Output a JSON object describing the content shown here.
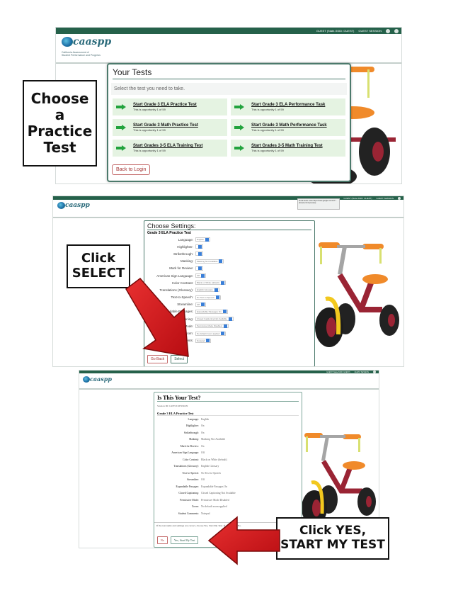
{
  "steps": [
    {
      "callout": "Choose a Practice Test",
      "callout_lines": [
        "Choose",
        "a",
        "Practice",
        "Test"
      ],
      "app": {
        "user_info": "GUEST (State-SSID: GUEST)",
        "session_label": "GUEST SESSION",
        "logo_word": "caaspp",
        "logo_sub": [
          "California Assessment of",
          "Student Performance and Progress"
        ]
      },
      "panel": {
        "title": "Your Tests",
        "instructions": "Select the test you need to take.",
        "tests": [
          {
            "label": "Start Grade 3 ELA Practice Test",
            "opportunity": "This is opportunity 1 of 59"
          },
          {
            "label": "Start Grade 3 ELA Performance Task",
            "opportunity": "This is opportunity 1 of 59"
          },
          {
            "label": "Start Grade 3 Math Practice Test",
            "opportunity": "This is opportunity 1 of 59"
          },
          {
            "label": "Start Grade 3 Math Performance Task",
            "opportunity": "This is opportunity 1 of 59"
          },
          {
            "label": "Start Grades 3-5 ELA Training Test",
            "opportunity": "This is opportunity 1 of 59"
          },
          {
            "label": "Start Grades 3-5 Math Training Test",
            "opportunity": "This is opportunity 1 of 59"
          }
        ],
        "back_button": "Back to Login"
      }
    },
    {
      "callout_lines": [
        "Click",
        "SELECT"
      ],
      "app": {
        "user_info": "GUEST (State-SSID: GUEST)",
        "session_label": "GUEST SESSION",
        "logo_word": "caaspp",
        "tooltip": "Kiosk Exam Links https://www.google.com/url?... (browser link preview)"
      },
      "panel": {
        "title": "Choose Settings:",
        "test_name": "Grade 3 ELA Practice Test",
        "settings": [
          {
            "label": "Language:",
            "value": "English"
          },
          {
            "label": "Highlighter:",
            "value": ""
          },
          {
            "label": "Strikethrough:",
            "value": ""
          },
          {
            "label": "Masking:",
            "value": "Masking Not Available"
          },
          {
            "label": "Mark for Review:",
            "value": ""
          },
          {
            "label": "American Sign Language:",
            "value": "Off"
          },
          {
            "label": "Color Contrast:",
            "value": "Black on White (default)"
          },
          {
            "label": "Translations (Glossary):",
            "value": "English Glossary"
          },
          {
            "label": "Text-to-Speech:",
            "value": "No Text-to-Speech"
          },
          {
            "label": "Streamline:",
            "value": "Off"
          },
          {
            "label": "Expandable Passages:",
            "value": "Expandable Passages On"
          },
          {
            "label": "Closed Captioning:",
            "value": "Closed Captioning Not Available"
          },
          {
            "label": "Permissive Mode:",
            "value": "Permissive Mode Disabled"
          },
          {
            "label": "Zoom:",
            "value": "No default zoom applied"
          },
          {
            "label": "Student Comments:",
            "value": "Notepad"
          }
        ],
        "go_back_button": "Go Back",
        "select_button": "Select"
      }
    },
    {
      "callout_lines": [
        "Click YES,",
        "START MY TEST"
      ],
      "app": {
        "user_info": "GUEST (State-SSID: GUEST)",
        "session_label": "GUEST SESSION",
        "logo_word": "caaspp"
      },
      "panel": {
        "title": "Is This Your Test?",
        "session_id": "Session ID: GUEST-SESSION",
        "test_name": "Grade 3 ELA Practice Test",
        "settings": [
          {
            "label": "Language:",
            "value": "English"
          },
          {
            "label": "Highlighter:",
            "value": "On"
          },
          {
            "label": "Strikethrough:",
            "value": "On"
          },
          {
            "label": "Masking:",
            "value": "Masking Not Available"
          },
          {
            "label": "Mark for Review:",
            "value": "On"
          },
          {
            "label": "American Sign Language:",
            "value": "Off"
          },
          {
            "label": "Color Contrast:",
            "value": "Black on White (default)"
          },
          {
            "label": "Translations (Glossary):",
            "value": "English Glossary"
          },
          {
            "label": "Text-to-Speech:",
            "value": "No Text-to-Speech"
          },
          {
            "label": "Streamline:",
            "value": "Off"
          },
          {
            "label": "Expandable Passages:",
            "value": "Expandable Passages On"
          },
          {
            "label": "Closed Captioning:",
            "value": "Closed Captioning Not Available"
          },
          {
            "label": "Permissive Mode:",
            "value": "Permissive Mode Disabled"
          },
          {
            "label": "Zoom:",
            "value": "No default zoom applied"
          },
          {
            "label": "Student Comments:",
            "value": "Notepad"
          }
        ],
        "footer_text": "If the test name and settings are correct, choose Yes, Start My Test. If not, choose No.",
        "no_button": "No",
        "yes_button": "Yes, Start My Test"
      }
    }
  ],
  "colors": {
    "header_green": "#25614a",
    "test_item_bg": "#e5f3e2",
    "arrow_green": "#22a33d",
    "callout_arrow_red": "#d0161b"
  }
}
